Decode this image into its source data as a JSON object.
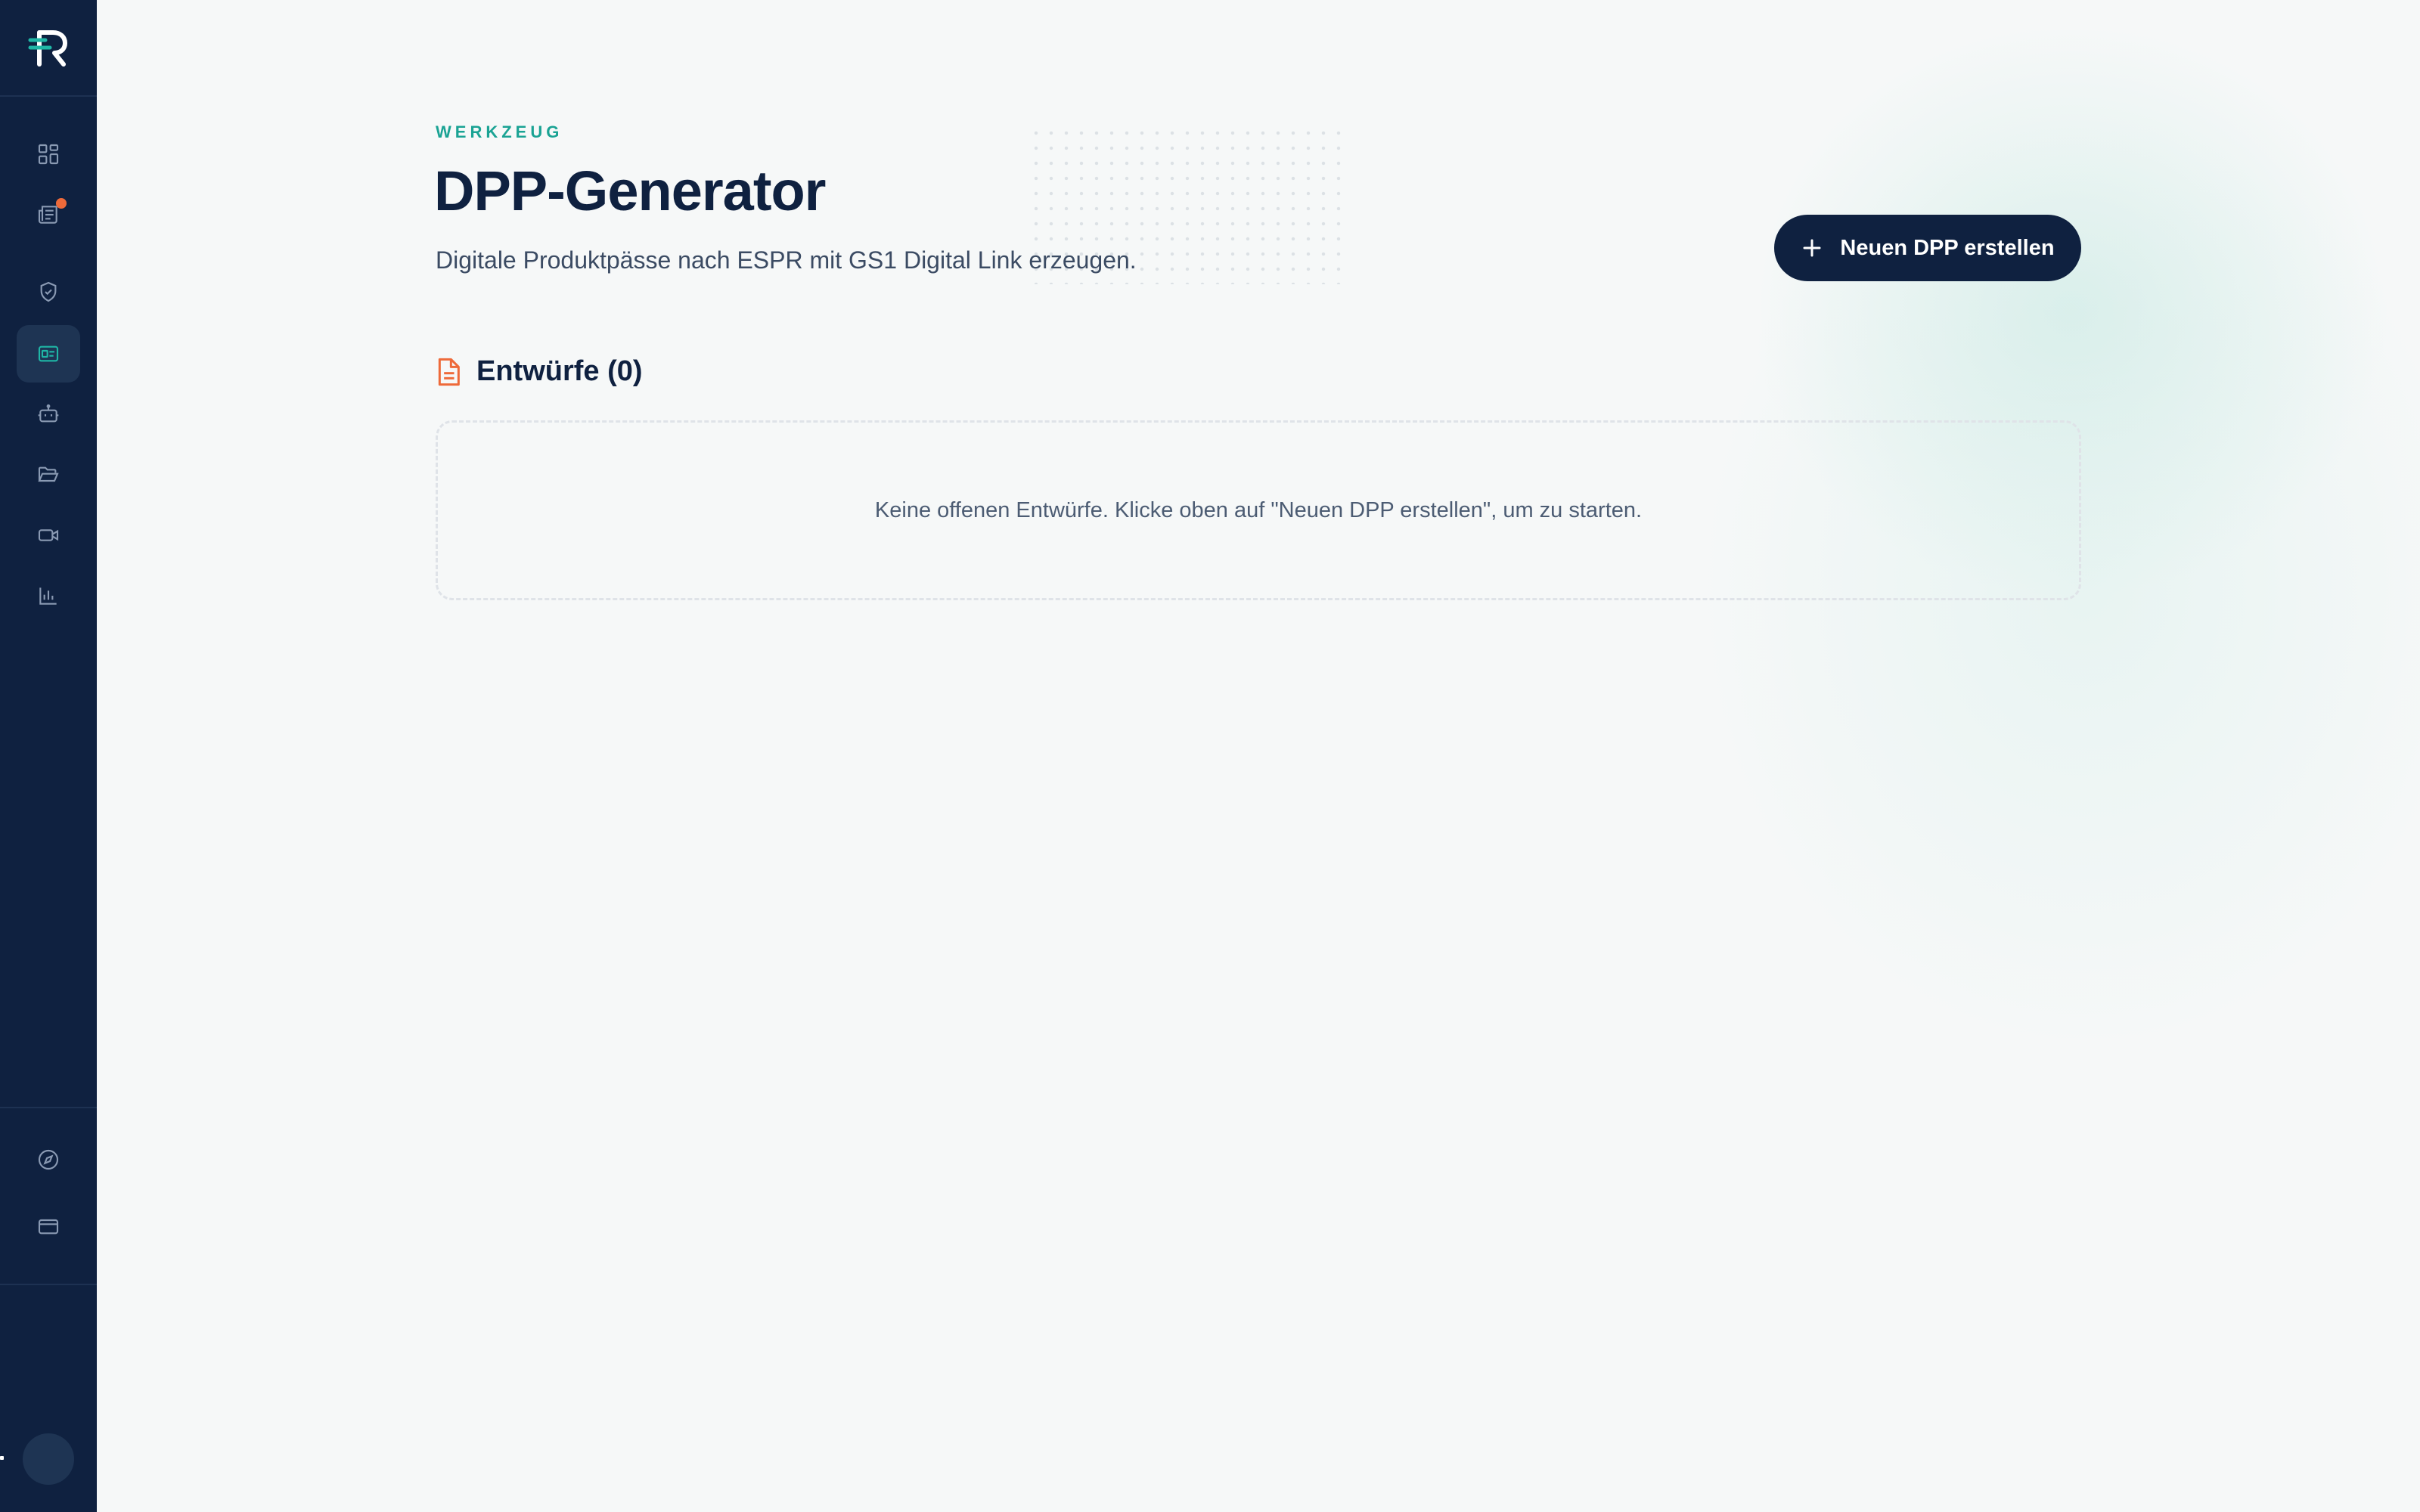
{
  "sidebar": {
    "logo_icon": "brand-r-logo",
    "items": [
      {
        "name": "dashboard",
        "icon": "grid-icon",
        "active": false,
        "badge": false
      },
      {
        "name": "news",
        "icon": "newspaper-icon",
        "active": false,
        "badge": true
      },
      {
        "name": "compliance",
        "icon": "shield-check-icon",
        "active": false,
        "badge": false
      },
      {
        "name": "dpp-generator",
        "icon": "id-card-icon",
        "active": true,
        "badge": false
      },
      {
        "name": "assistant",
        "icon": "robot-icon",
        "active": false,
        "badge": false
      },
      {
        "name": "files",
        "icon": "folder-open-icon",
        "active": false,
        "badge": false
      },
      {
        "name": "video",
        "icon": "video-camera-icon",
        "active": false,
        "badge": false
      },
      {
        "name": "analytics",
        "icon": "bar-chart-icon",
        "active": false,
        "badge": false
      }
    ],
    "bottom_items": [
      {
        "name": "explore",
        "icon": "compass-icon"
      },
      {
        "name": "billing",
        "icon": "credit-card-icon"
      }
    ]
  },
  "header": {
    "eyebrow": "WERKZEUG",
    "title": "DPP-Generator",
    "subtitle": "Digitale Produktpässe nach ESPR mit GS1 Digital Link erzeugen.",
    "create_button_label": "Neuen DPP erstellen"
  },
  "drafts": {
    "title": "Entwürfe (0)",
    "empty_message": "Keine offenen Entwürfe. Klicke oben auf \"Neuen DPP erstellen\", um zu starten."
  },
  "colors": {
    "sidebar_bg": "#0f2140",
    "accent_teal": "#1aa394",
    "accent_orange": "#ee6a3a",
    "page_bg": "#f6f8f8",
    "title_text": "#0f2140"
  }
}
